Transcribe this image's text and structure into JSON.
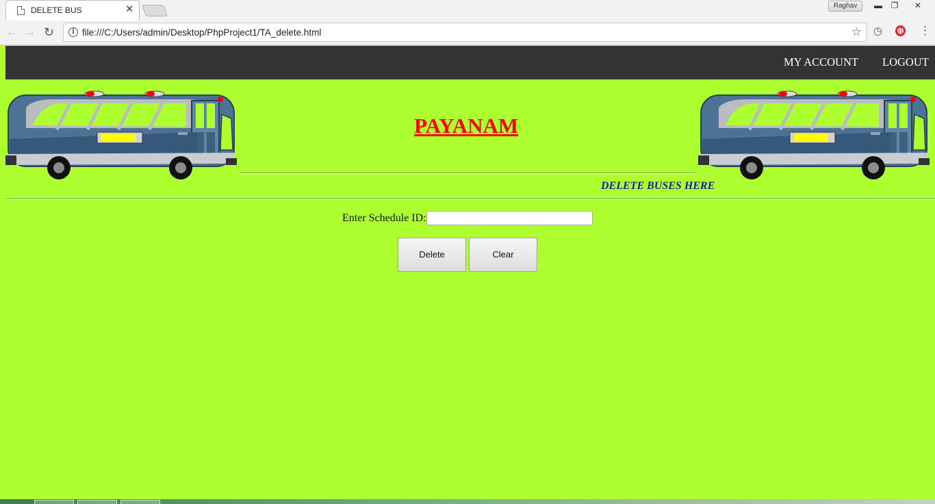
{
  "browser": {
    "tab_title": "DELETE BUS",
    "tab_close": "✕",
    "url": "file:///C:/Users/admin/Desktop/PhpProject1/TA_delete.html",
    "profile_name": "Raghav",
    "info_glyph": "i",
    "icons": [
      "page-icon",
      "back-arrow-icon",
      "forward-arrow-icon",
      "reload-icon",
      "info-icon",
      "star-icon",
      "history-icon",
      "opera-icon",
      "menu-icon"
    ]
  },
  "nav": {
    "my_account": "MY ACCOUNT",
    "logout": "LOGOUT"
  },
  "header": {
    "brand": "PAYANAM",
    "subtitle": "DELETE BUSES HERE"
  },
  "form": {
    "schedule_label": "Enter Schedule ID:",
    "schedule_value": "",
    "delete_label": "Delete",
    "clear_label": "Clear"
  },
  "colors": {
    "page_background": "#adff2f",
    "navbar": "#333333",
    "brand": "#ff0000",
    "subtitle": "#1a1aa8"
  }
}
